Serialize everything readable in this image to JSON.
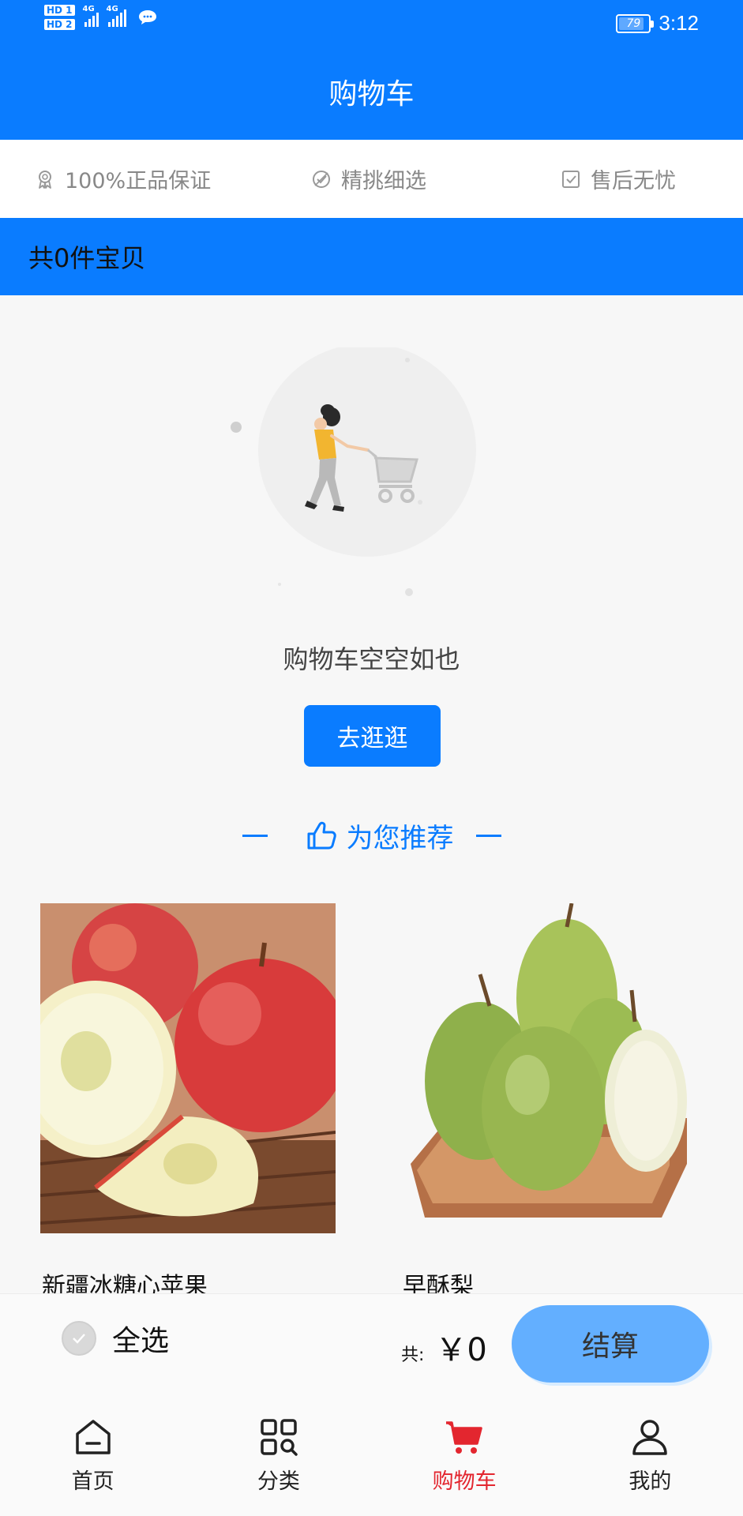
{
  "status_bar": {
    "hd1": "HD 1",
    "hd2": "HD 2",
    "network1": "4G",
    "network2": "4G",
    "battery": "79",
    "time": "3:12"
  },
  "header": {
    "title": "购物车"
  },
  "guarantees": [
    {
      "icon": "medal-icon",
      "label": "100%正品保证"
    },
    {
      "icon": "badge-check-icon",
      "label": "精挑细选"
    },
    {
      "icon": "checkbox-icon",
      "label": "售后无忧"
    }
  ],
  "cart_count": "共0件宝贝",
  "empty_state": {
    "message": "购物车空空如也",
    "button_label": "去逛逛",
    "illustration": "woman-pushing-cart-illustration"
  },
  "recommend": {
    "icon": "thumbs-up-icon",
    "title": "为您推荐",
    "products": [
      {
        "name": "新疆冰糖心苹果",
        "image": "apples-photo"
      },
      {
        "name": "早酥梨",
        "image": "pears-photo"
      }
    ]
  },
  "checkout": {
    "select_all_label": "全选",
    "total_label": "共:",
    "total_value": "￥0",
    "button_label": "结算"
  },
  "tabs": [
    {
      "label": "首页",
      "icon": "home-icon",
      "active": false
    },
    {
      "label": "分类",
      "icon": "category-grid-icon",
      "active": false
    },
    {
      "label": "购物车",
      "icon": "cart-icon",
      "active": true
    },
    {
      "label": "我的",
      "icon": "user-icon",
      "active": false
    }
  ],
  "colors": {
    "primary": "#0a7cff",
    "active_tab": "#e3262f",
    "checkout_button": "#63afff"
  }
}
